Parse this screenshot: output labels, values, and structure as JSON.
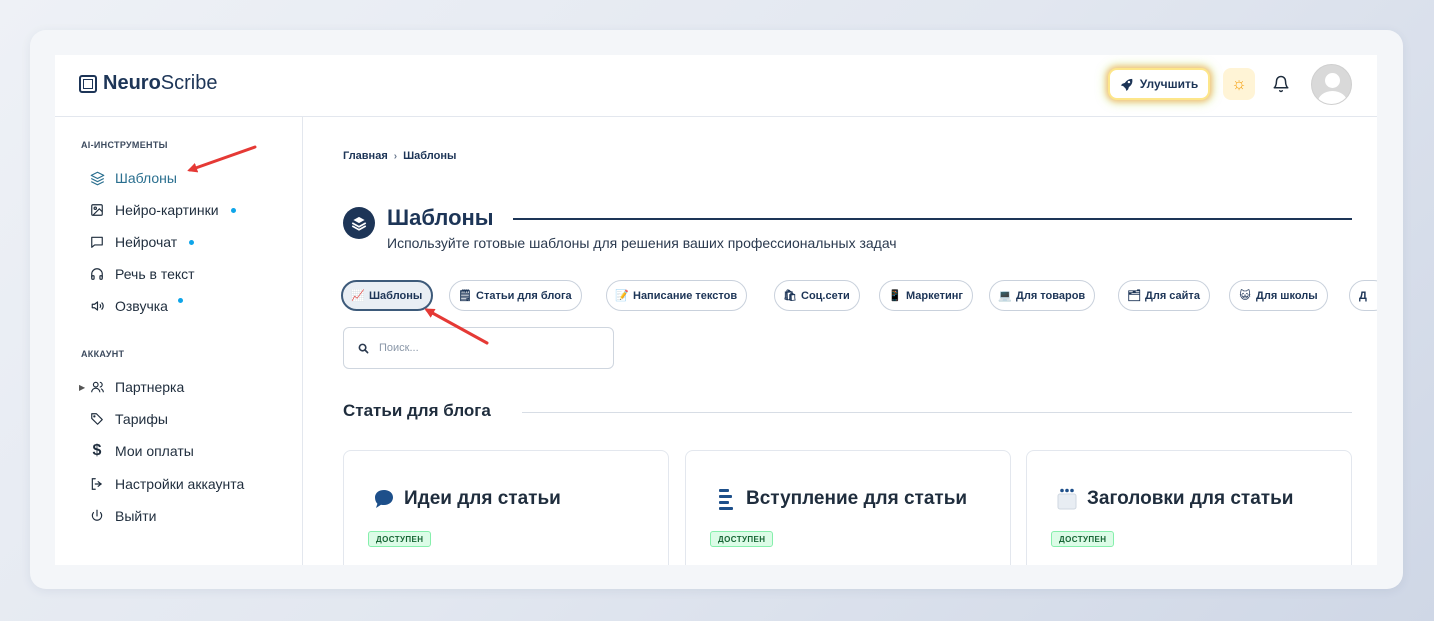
{
  "header": {
    "logo_bold": "Neuro",
    "logo_rest": "Scribe",
    "upgrade_label": "Улучшить"
  },
  "sidebar": {
    "section_tools": "AI-ИНСТРУМЕНТЫ",
    "tools": [
      {
        "label": "Шаблоны",
        "icon": "layers-icon",
        "active": true
      },
      {
        "label": "Нейро-картинки",
        "icon": "image-icon",
        "dot": true
      },
      {
        "label": "Нейрочат",
        "icon": "chat-icon",
        "dot": true
      },
      {
        "label": "Речь в текст",
        "icon": "headphones-icon"
      },
      {
        "label": "Озвучка",
        "icon": "speaker-icon",
        "dot": true
      }
    ],
    "section_account": "АККАУНТ",
    "account": [
      {
        "label": "Партнерка",
        "icon": "users-icon",
        "expandable": true
      },
      {
        "label": "Тарифы",
        "icon": "tag-icon"
      },
      {
        "label": "Мои оплаты",
        "icon": "dollar-icon"
      },
      {
        "label": "Настройки аккаунта",
        "icon": "logout-arrow-icon"
      },
      {
        "label": "Выйти",
        "icon": "power-icon"
      }
    ]
  },
  "main": {
    "breadcrumb": {
      "home": "Главная",
      "separator": "›",
      "current": "Шаблоны"
    },
    "title": "Шаблоны",
    "subtitle": "Используйте готовые шаблоны для решения ваших профессиональных задач",
    "chips": [
      {
        "label": "Шаблоны",
        "emoji": "📈",
        "active": true
      },
      {
        "label": "Статьи для блога",
        "emoji": "🗒"
      },
      {
        "label": "Написание текстов",
        "emoji": "📝"
      },
      {
        "label": "Соц.сети",
        "emoji": "🛍"
      },
      {
        "label": "Маркетинг",
        "emoji": "📱"
      },
      {
        "label": "Для товаров",
        "emoji": "💻"
      },
      {
        "label": "Для сайта",
        "emoji": "🗂"
      },
      {
        "label": "Для школы",
        "emoji": "😺"
      },
      {
        "label": "Д",
        "emoji": ""
      }
    ],
    "search_placeholder": "Поиск...",
    "section_heading": "Статьи для блога",
    "cards": [
      {
        "title": "Идеи для статьи",
        "icon": "speech-bubble-icon",
        "badge": "ДОСТУПЕН"
      },
      {
        "title": "Вступление для статьи",
        "icon": "text-lines-icon",
        "badge": "ДОСТУПЕН"
      },
      {
        "title": "Заголовки для статьи",
        "icon": "clapper-icon",
        "badge": "ДОСТУПЕН"
      }
    ]
  },
  "colors": {
    "primary": "#1d3557",
    "active": "#2a6f8f",
    "dot": "#0ea5e9",
    "badge_bg": "#dcfce7",
    "annotation": "#e53935"
  }
}
